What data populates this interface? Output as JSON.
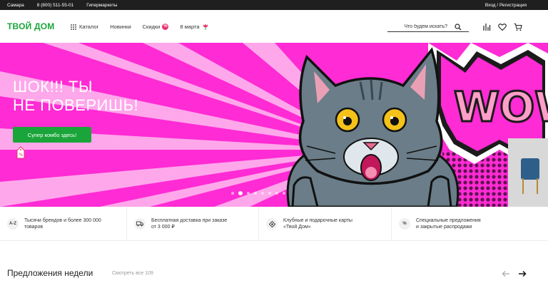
{
  "topbar": {
    "city": "Самара",
    "phone": "8 (800) 511-55-01",
    "stores": "Гипермаркеты",
    "login": "Вход / Регистрация"
  },
  "header": {
    "logo": "ТВОЙ ДОМ",
    "nav": {
      "catalog": "Каталог",
      "new": "Новинки",
      "sales": "Скидки",
      "sales_badge": "%",
      "march8": "8 марта"
    },
    "search_placeholder": "Что будем искать?",
    "brand_color": "#1aa53a",
    "accent_color": "#e8336d"
  },
  "banner": {
    "headline": "ШОК!!! ТЫ\nНЕ ПОВЕРИШЬ!",
    "cta": "Супер комбо здесь!",
    "art_text": "WOW",
    "background_color": "#ff2bd4",
    "slide_count": 8,
    "active_slide": 2
  },
  "features": [
    {
      "icon": "A-Z",
      "text": "Тысячи брендов и более 300 000\nтоваров"
    },
    {
      "icon": "truck-icon",
      "text": "Бесплатная доставка при заказе\nот 3 000 ₽"
    },
    {
      "icon": "card-icon",
      "text": "Клубные и подарочные карты\n«Твой Дом»"
    },
    {
      "icon": "%",
      "text": "Специальные предложения\nи закрытые распродажи"
    }
  ],
  "section": {
    "title": "Предложения недели",
    "link": "Смотреть все 109"
  }
}
